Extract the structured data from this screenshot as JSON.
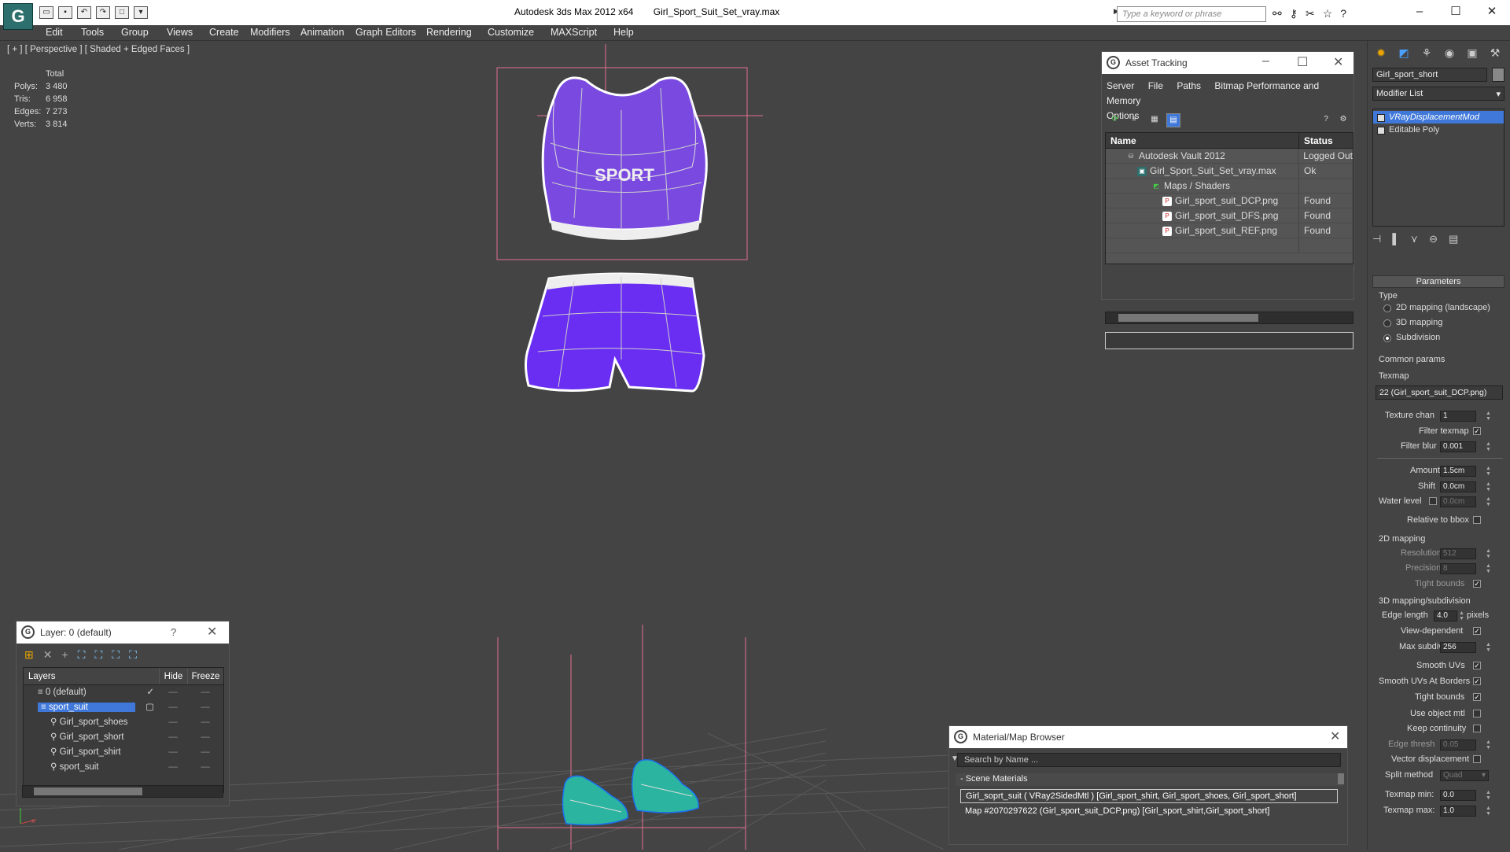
{
  "app": {
    "title": "Autodesk 3ds Max  2012 x64",
    "file": "Girl_Sport_Suit_Set_vray.max",
    "search_placeholder": "Type a keyword or phrase"
  },
  "menu": [
    "Edit",
    "Tools",
    "Group",
    "Views",
    "Create",
    "Modifiers",
    "Animation",
    "Graph Editors",
    "Rendering",
    "Customize",
    "MAXScript",
    "Help"
  ],
  "viewport": {
    "label": "[ + ] [ Perspective ] [ Shaded + Edged Faces ]",
    "stats_header": "Total",
    "stats": [
      {
        "k": "Polys:",
        "v": "3 480"
      },
      {
        "k": "Tris:",
        "v": "6 958"
      },
      {
        "k": "Edges:",
        "v": "7 273"
      },
      {
        "k": "Verts:",
        "v": "3 814"
      }
    ],
    "shirt_text": "SPORT"
  },
  "asset_tracking": {
    "title": "Asset Tracking",
    "menus": [
      "Server",
      "File",
      "Paths",
      "Bitmap Performance and Memory",
      "Options"
    ],
    "col_name": "Name",
    "col_status": "Status",
    "rows": [
      {
        "name": "Autodesk Vault 2012",
        "status": "Logged Out",
        "icon": "vault-icon"
      },
      {
        "name": "Girl_Sport_Suit_Set_vray.max",
        "status": "Ok",
        "icon": "max-file-icon"
      },
      {
        "name": "Maps / Shaders",
        "status": "",
        "icon": "maps-icon"
      },
      {
        "name": "Girl_sport_suit_DCP.png",
        "status": "Found",
        "icon": "png-icon"
      },
      {
        "name": "Girl_sport_suit_DFS.png",
        "status": "Found",
        "icon": "png-icon"
      },
      {
        "name": "Girl_sport_suit_REF.png",
        "status": "Found",
        "icon": "png-icon"
      }
    ]
  },
  "layer": {
    "title": "Layer: 0 (default)",
    "col_layers": "Layers",
    "col_hide": "Hide",
    "col_freeze": "Freeze",
    "rows": [
      {
        "name": "0 (default)",
        "indent": 1,
        "selected": false
      },
      {
        "name": "sport_suit",
        "indent": 1,
        "selected": true
      },
      {
        "name": "Girl_sport_shoes",
        "indent": 2,
        "selected": false
      },
      {
        "name": "Girl_sport_short",
        "indent": 2,
        "selected": false
      },
      {
        "name": "Girl_sport_shirt",
        "indent": 2,
        "selected": false
      },
      {
        "name": "sport_suit",
        "indent": 2,
        "selected": false
      }
    ]
  },
  "material_browser": {
    "title": "Material/Map Browser",
    "search_placeholder": "Search by Name ...",
    "section": "- Scene Materials",
    "items": [
      "Girl_soprt_suit ( VRay2SidedMtl ) [Girl_sport_shirt, Girl_sport_shoes, Girl_sport_short]",
      "Map #2070297622 (Girl_sport_suit_DCP.png) [Girl_sport_shirt,Girl_sport_short]"
    ]
  },
  "command_panel": {
    "object_name": "Girl_sport_short",
    "modifier_list": "Modifier List",
    "stack": [
      "VRayDisplacementMod",
      "Editable Poly"
    ],
    "parameters": "Parameters",
    "type_label": "Type",
    "type_options": [
      "2D mapping (landscape)",
      "3D mapping",
      "Subdivision"
    ],
    "common_params": "Common params",
    "texmap_label": "Texmap",
    "texmap_value": "22 (Girl_sport_suit_DCP.png)",
    "texture_chan_label": "Texture chan",
    "texture_chan": "1",
    "filter_texmap_label": "Filter texmap",
    "filter_blur_label": "Filter blur",
    "filter_blur": "0.001",
    "amount_label": "Amount",
    "amount": "1.5cm",
    "shift_label": "Shift",
    "shift": "0.0cm",
    "water_level_label": "Water level",
    "water_level": "0.0cm",
    "relative_bbox_label": "Relative to bbox",
    "mapping2d": "2D mapping",
    "resolution_label": "Resolution",
    "resolution": "512",
    "precision_label": "Precision",
    "precision": "8",
    "tight_bounds_label": "Tight bounds",
    "mapping3d": "3D mapping/subdivision",
    "edge_length_label": "Edge length",
    "edge_length": "4.0",
    "pixels_label": "pixels",
    "view_dependent_label": "View-dependent",
    "max_subdivs_label": "Max subdivs",
    "max_subdivs": "256",
    "smooth_uvs_label": "Smooth UVs",
    "smooth_uvs_borders_label": "Smooth UVs At Borders",
    "tight_bounds2_label": "Tight bounds",
    "use_object_mtl_label": "Use object mtl",
    "keep_continuity_label": "Keep continuity",
    "edge_thresh_label": "Edge thresh",
    "edge_thresh": "0.05",
    "vector_disp_label": "Vector displacement",
    "split_method_label": "Split method",
    "split_method": "Quad",
    "texmap_min_label": "Texmap min:",
    "texmap_min": "0.0",
    "texmap_max_label": "Texmap max:",
    "texmap_max": "1.0"
  },
  "colors": {
    "accent": "#3f78d9",
    "shirt": "#7a4ae0",
    "short": "#6a2ef2",
    "shoes": "#2bb5a0"
  }
}
